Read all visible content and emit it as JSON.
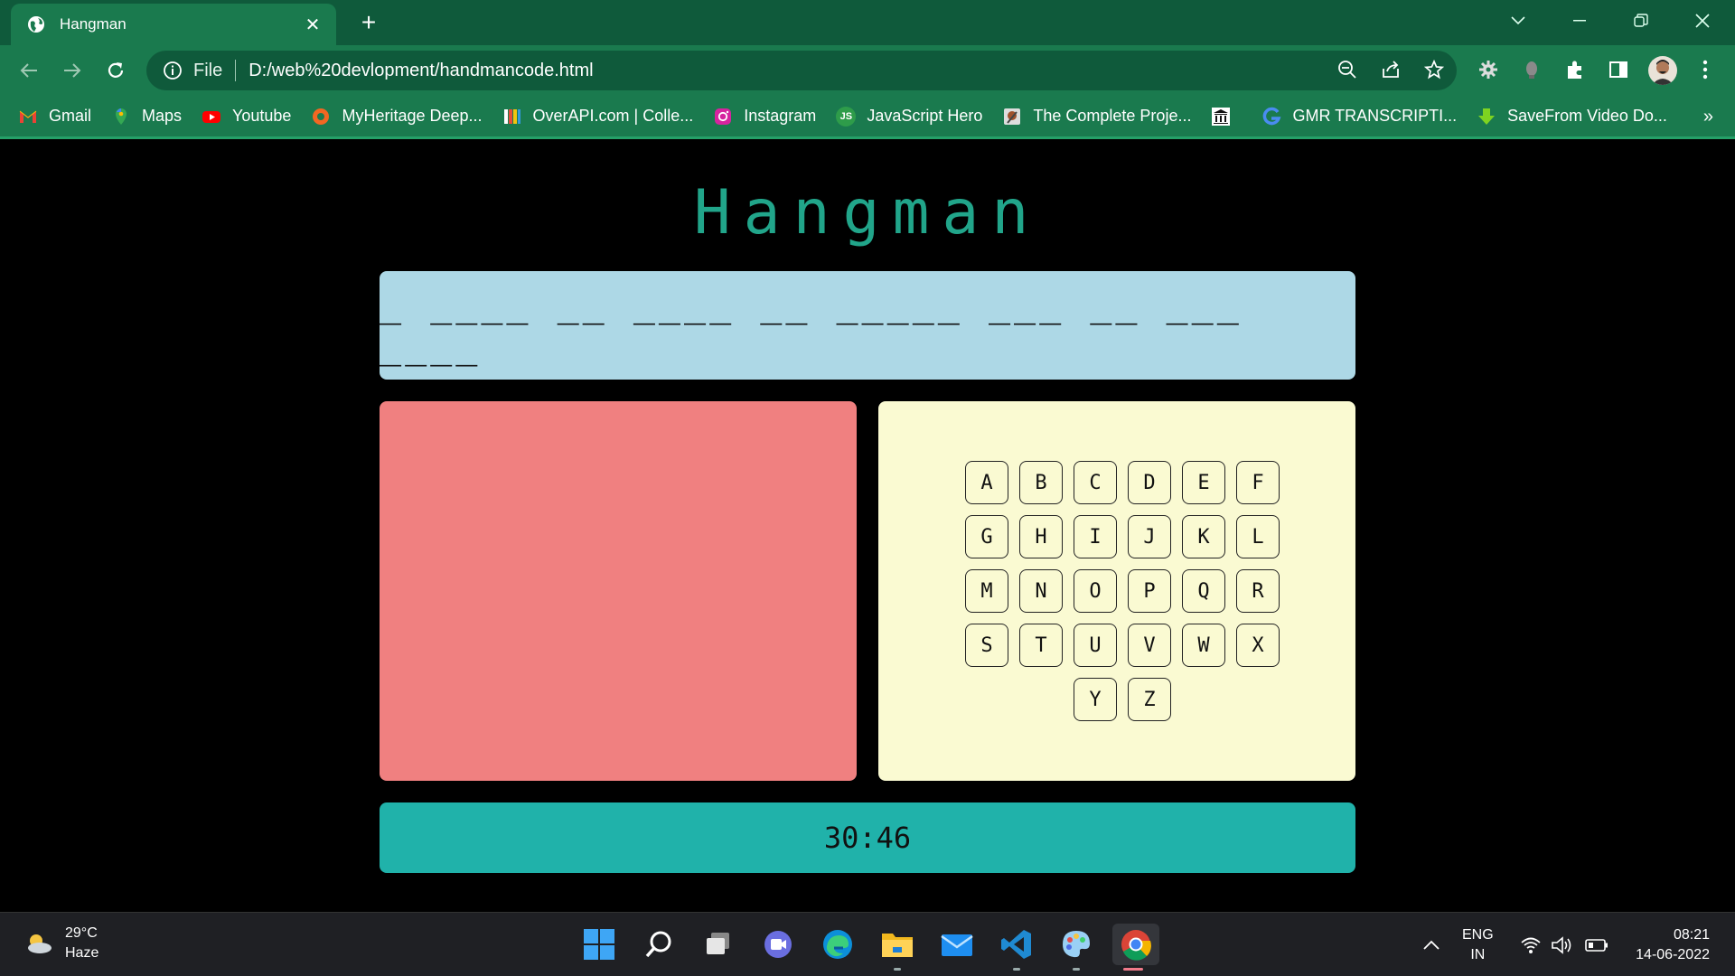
{
  "browser": {
    "tab_title": "Hangman",
    "url_scheme_label": "File",
    "url": "D:/web%20devlopment/handmancode.html",
    "bookmarks": [
      {
        "label": "Gmail",
        "icon": "gmail-icon"
      },
      {
        "label": "Maps",
        "icon": "maps-icon"
      },
      {
        "label": "Youtube",
        "icon": "youtube-icon"
      },
      {
        "label": "MyHeritage Deep...",
        "icon": "myheritage-icon"
      },
      {
        "label": "OverAPI.com | Colle...",
        "icon": "overapi-icon"
      },
      {
        "label": "Instagram",
        "icon": "instagram-icon"
      },
      {
        "label": "JavaScript Hero",
        "icon": "javascript-hero-icon"
      },
      {
        "label": "The Complete Proje...",
        "icon": "complete-project-icon"
      },
      {
        "label": "",
        "icon": "institution-icon"
      },
      {
        "label": "GMR TRANSCRIPTI...",
        "icon": "gmr-icon"
      },
      {
        "label": "SaveFrom Video Do...",
        "icon": "savefrom-icon"
      }
    ],
    "bookmarks_more": "»",
    "tab_close": "✕",
    "new_tab": "+"
  },
  "game": {
    "title": "Hangman",
    "word_display": "_ ____ __ ____ __ _____ ___ __ ___ ____",
    "letters": [
      "A",
      "B",
      "C",
      "D",
      "E",
      "F",
      "G",
      "H",
      "I",
      "J",
      "K",
      "L",
      "M",
      "N",
      "O",
      "P",
      "Q",
      "R",
      "S",
      "T",
      "U",
      "V",
      "W",
      "X",
      "Y",
      "Z"
    ],
    "timer": "30:46"
  },
  "taskbar": {
    "weather_temp": "29°C",
    "weather_desc": "Haze",
    "lang_line1": "ENG",
    "lang_line2": "IN",
    "time": "08:21",
    "date": "14-06-2022"
  },
  "colors": {
    "title": "#21a58a",
    "word_panel": "#add8e6",
    "hangman_panel": "#f08080",
    "letters_panel": "#fafad2",
    "timer_bar": "#20b2aa"
  }
}
